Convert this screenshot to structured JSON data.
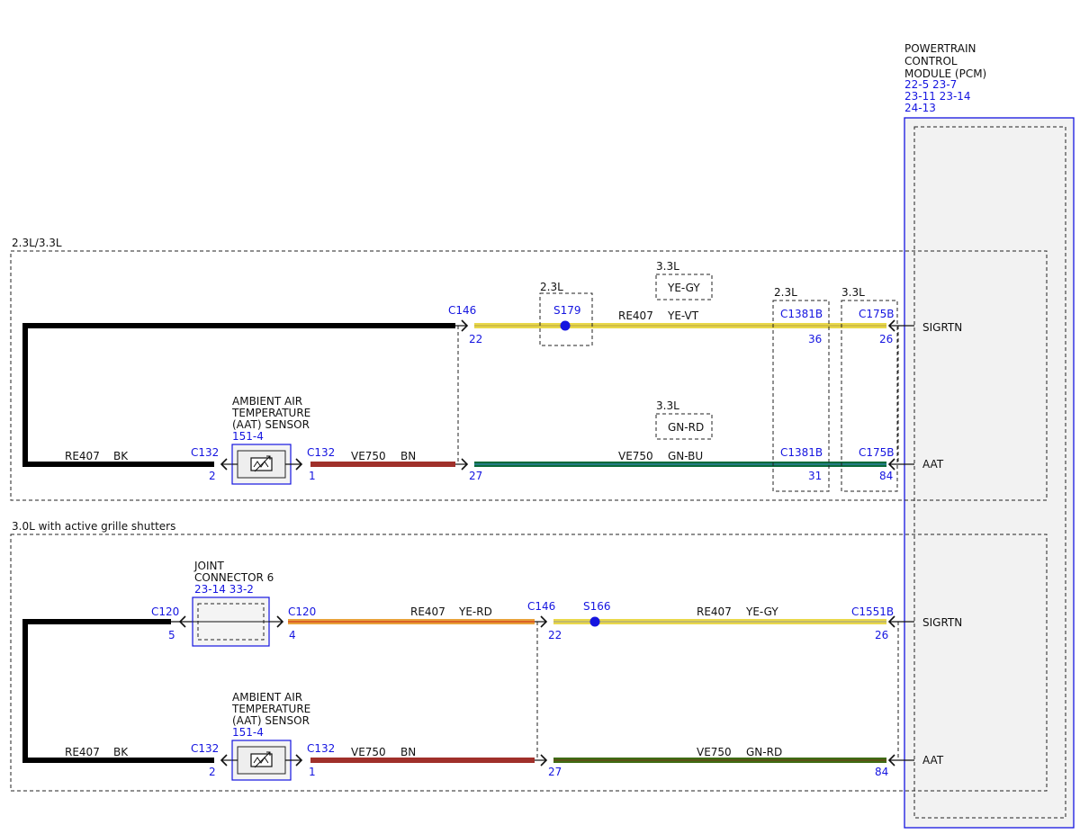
{
  "pcm": {
    "title_lines": [
      "POWERTRAIN",
      "CONTROL",
      "MODULE (PCM)"
    ],
    "ref_lines": [
      "22-5   23-7",
      "23-11 23-14",
      "24-13"
    ],
    "pins": {
      "sigrtn": "SIGRTN",
      "aat": "AAT"
    }
  },
  "section_a": {
    "label": "2.3L/3.3L",
    "sensor": {
      "lines": [
        "AMBIENT AIR",
        "TEMPERATURE",
        "(AAT) SENSOR"
      ],
      "ref": "151-4"
    },
    "c132_left": {
      "name": "C132",
      "pin": "2"
    },
    "c132_right": {
      "name": "C132",
      "pin": "1"
    },
    "gnd_wire": {
      "circuit": "RE407",
      "color": "BK"
    },
    "sensor_wire": {
      "circuit": "VE750",
      "color": "BN"
    },
    "c146": {
      "name": "C146",
      "pin_top": "22",
      "pin_bottom": "27"
    },
    "s179": {
      "name": "S179",
      "tag": "2.3L"
    },
    "top_wire": {
      "circuit": "RE407",
      "color": "YE-VT"
    },
    "alt_top": {
      "tag": "3.3L",
      "color": "YE-GY"
    },
    "alt_bottom": {
      "tag": "3.3L",
      "color": "GN-RD"
    },
    "bottom_wire": {
      "circuit": "VE750",
      "color": "GN-BU"
    },
    "c1381b": {
      "tag": "2.3L",
      "name_top": "C1381B",
      "pin_top": "36",
      "name_bottom": "C1381B",
      "pin_bottom": "31"
    },
    "c175b": {
      "tag": "3.3L",
      "name_top": "C175B",
      "pin_top": "26",
      "name_bottom": "C175B",
      "pin_bottom": "84"
    }
  },
  "section_b": {
    "label": "3.0L with active grille shutters",
    "joint": {
      "lines": [
        "JOINT",
        "CONNECTOR 6"
      ],
      "ref": "23-14 33-2"
    },
    "c120_left": {
      "name": "C120",
      "pin": "5"
    },
    "c120_right": {
      "name": "C120",
      "pin": "4"
    },
    "joint_wire": {
      "circuit": "RE407",
      "color": "YE-RD"
    },
    "c146": {
      "name": "C146",
      "pin_top": "22",
      "pin_bottom": "27"
    },
    "s166": {
      "name": "S166"
    },
    "top_wire": {
      "circuit": "RE407",
      "color": "YE-GY"
    },
    "c1551b": {
      "name": "C1551B",
      "pin": "26"
    },
    "sensor": {
      "lines": [
        "AMBIENT AIR",
        "TEMPERATURE",
        "(AAT) SENSOR"
      ],
      "ref": "151-4"
    },
    "c132_left": {
      "name": "C132",
      "pin": "2"
    },
    "c132_right": {
      "name": "C132",
      "pin": "1"
    },
    "gnd_wire": {
      "circuit": "RE407",
      "color": "BK"
    },
    "sensor_wire": {
      "circuit": "VE750",
      "color": "BN"
    },
    "bottom_wire": {
      "circuit": "VE750",
      "color": "GN-RD"
    },
    "pcm_pin_bottom": "84"
  },
  "colors": {
    "blue_text": "#1515e0",
    "black_wire": "#000000",
    "brown_wire": "#a0302a",
    "green_blue_wire": "#0b6b3a",
    "green_red_wire": "#3f6b14",
    "yellow_wire": "#e9d84a",
    "yellow_red_wire": "#e8a23a",
    "splice": "#1515e0"
  }
}
